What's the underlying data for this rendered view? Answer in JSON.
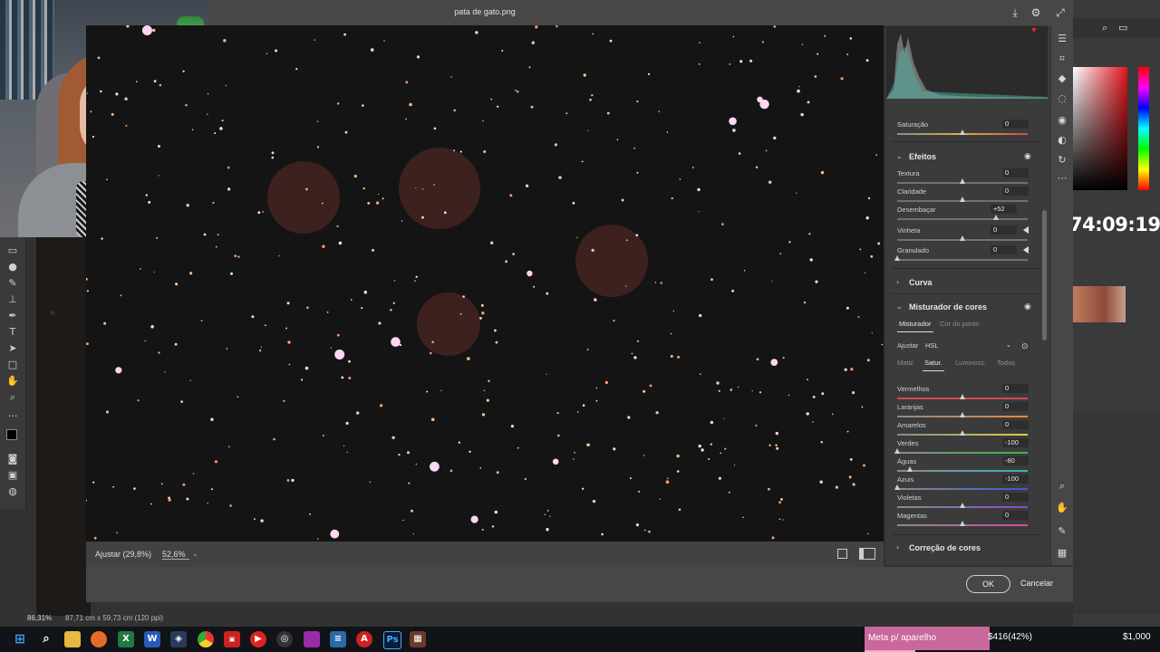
{
  "document_title": "pata de gato.png",
  "preview": {
    "zoom_label": "Ajustar (29,8%)",
    "zoom_value": "52,6%"
  },
  "panel": {
    "saturacao": {
      "label": "Saturação",
      "value": "0"
    },
    "efeitos": {
      "title": "Efeitos",
      "sliders": [
        {
          "label": "Textura",
          "value": "0"
        },
        {
          "label": "Claridade",
          "value": "0"
        },
        {
          "label": "Desembaçar",
          "value": "+52"
        },
        {
          "label": "Vinheta",
          "value": "0"
        },
        {
          "label": "Granulado",
          "value": "0"
        }
      ]
    },
    "curva": {
      "title": "Curva"
    },
    "misturador": {
      "title": "Misturador de cores",
      "tabs": [
        "Misturador",
        "Cor do ponto"
      ],
      "ajustar_label": "Ajustar",
      "ajustar_value": "HSL",
      "subtabs": [
        "Matiz",
        "Satur.",
        "Luminosc.",
        "Todos"
      ],
      "sliders": [
        {
          "label": "Vermelhos",
          "value": "0",
          "color_left": "#d24a4a",
          "color_right": "#d24a4a"
        },
        {
          "label": "Laranjas",
          "value": "0",
          "color_left": "#8a8a8a",
          "color_right": "#e88a3a"
        },
        {
          "label": "Amarelos",
          "value": "0",
          "color_left": "#8a8a8a",
          "color_right": "#e0d040"
        },
        {
          "label": "Verdes",
          "value": "-100",
          "color_left": "#8a8a8a",
          "color_right": "#3aba4a"
        },
        {
          "label": "Águas",
          "value": "-80",
          "color_left": "#8a8a8a",
          "color_right": "#3ab0c0"
        },
        {
          "label": "Azuis",
          "value": "-100",
          "color_left": "#8a8a8a",
          "color_right": "#3a5ad0"
        },
        {
          "label": "Violetas",
          "value": "0",
          "color_left": "#8a8a8a",
          "color_right": "#8a4ad0"
        },
        {
          "label": "Magentas",
          "value": "0",
          "color_left": "#8a8a8a",
          "color_right": "#d04aa8"
        }
      ]
    },
    "correcao": {
      "title": "Correção de cores"
    }
  },
  "buttons": {
    "ok": "OK",
    "cancel": "Cancelar"
  },
  "photoshop": {
    "zoom": "86,31%",
    "doc_info": "87,71 cm x 59,73 cm (120 ppi)"
  },
  "stream": {
    "timer": "74:09:19",
    "goal_label": "Meta p/ aparelho",
    "goal_amount": "$416(42%)",
    "goal_total": "$1,000",
    "goal_progress": 0.42
  },
  "colors": {
    "accent_goal": "#c9689a",
    "dialog_bg": "#474747",
    "panel_bg": "#3b3b3b"
  }
}
